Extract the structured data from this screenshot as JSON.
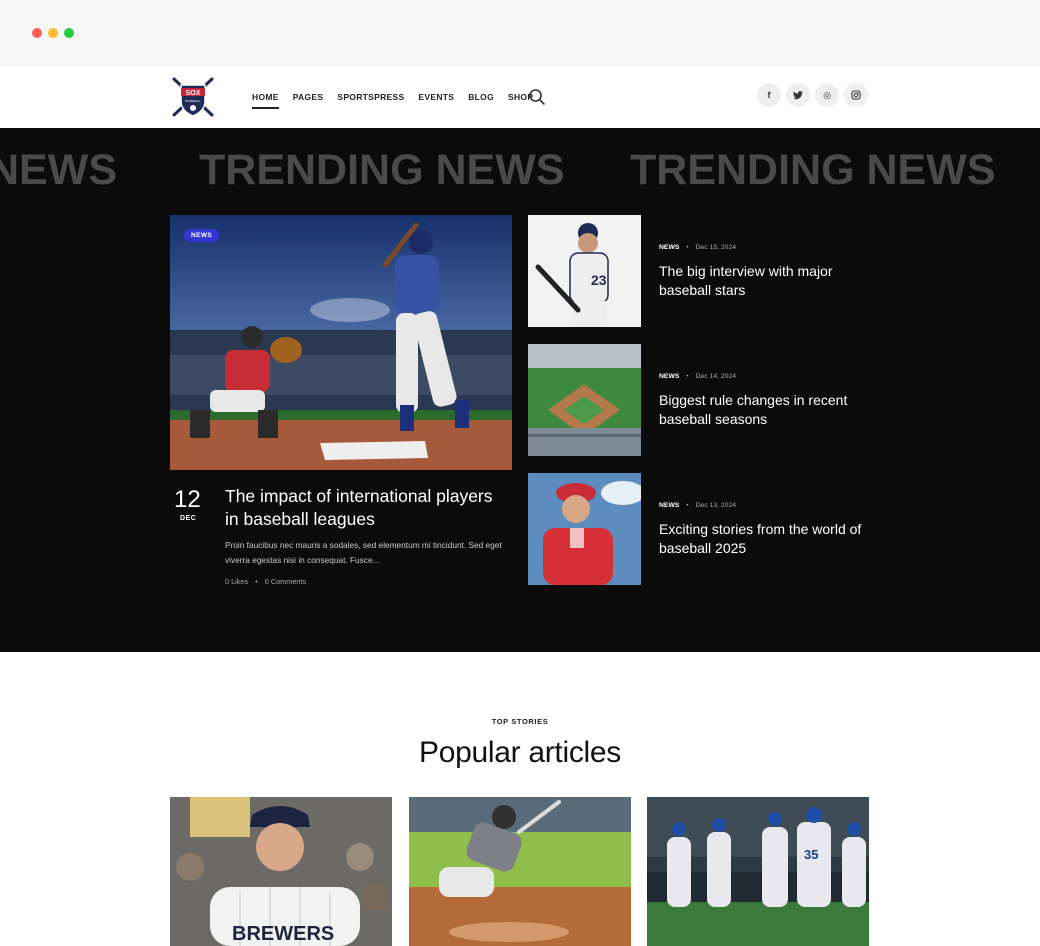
{
  "colors": {
    "accent": "#3536d6",
    "hero_bg": "#0b0b0b",
    "marquee_text": "#4a4a4a",
    "traffic_red": "#ff5f57",
    "traffic_yellow": "#febc2e",
    "traffic_green": "#28c840"
  },
  "header": {
    "logo_text": "SOX",
    "logo_sub": "BASEBALL",
    "nav": [
      {
        "label": "HOME",
        "active": true
      },
      {
        "label": "PAGES"
      },
      {
        "label": "SPORTSPRESS"
      },
      {
        "label": "EVENTS"
      },
      {
        "label": "BLOG"
      },
      {
        "label": "SHOP"
      }
    ],
    "search_icon": "search-icon",
    "socials": [
      {
        "icon": "facebook-icon",
        "glyph": "f"
      },
      {
        "icon": "twitter-icon",
        "glyph": "t"
      },
      {
        "icon": "dribbble-icon",
        "glyph": "◎"
      },
      {
        "icon": "instagram-icon",
        "glyph": "◘"
      }
    ]
  },
  "hero": {
    "marquee": [
      "NEWS",
      "TRENDING NEWS",
      "TRENDING NEWS"
    ],
    "feature": {
      "badge": "NEWS",
      "day": "12",
      "month": "DEC",
      "title": "The impact of international players in baseball leagues",
      "excerpt": "Proin faucibus nec mauris a sodales, sed elementum mi tincidunt. Sed eget viverra egestas nisi in consequat. Fusce...",
      "likes": "0 Likes",
      "comments": "0 Comments"
    },
    "side": [
      {
        "category": "NEWS",
        "date": "Dec 15, 2024",
        "title": "The big interview with major baseball stars"
      },
      {
        "category": "NEWS",
        "date": "Dec 14, 2024",
        "title": "Biggest rule changes in recent baseball seasons"
      },
      {
        "category": "NEWS",
        "date": "Dec 13, 2024",
        "title": "Exciting stories from the world of baseball 2025"
      }
    ]
  },
  "popular": {
    "kicker": "TOP STORIES",
    "title": "Popular articles",
    "cards": [
      {
        "jersey_text": "BREWERS"
      },
      {},
      {
        "jersey_number": "35"
      }
    ]
  }
}
